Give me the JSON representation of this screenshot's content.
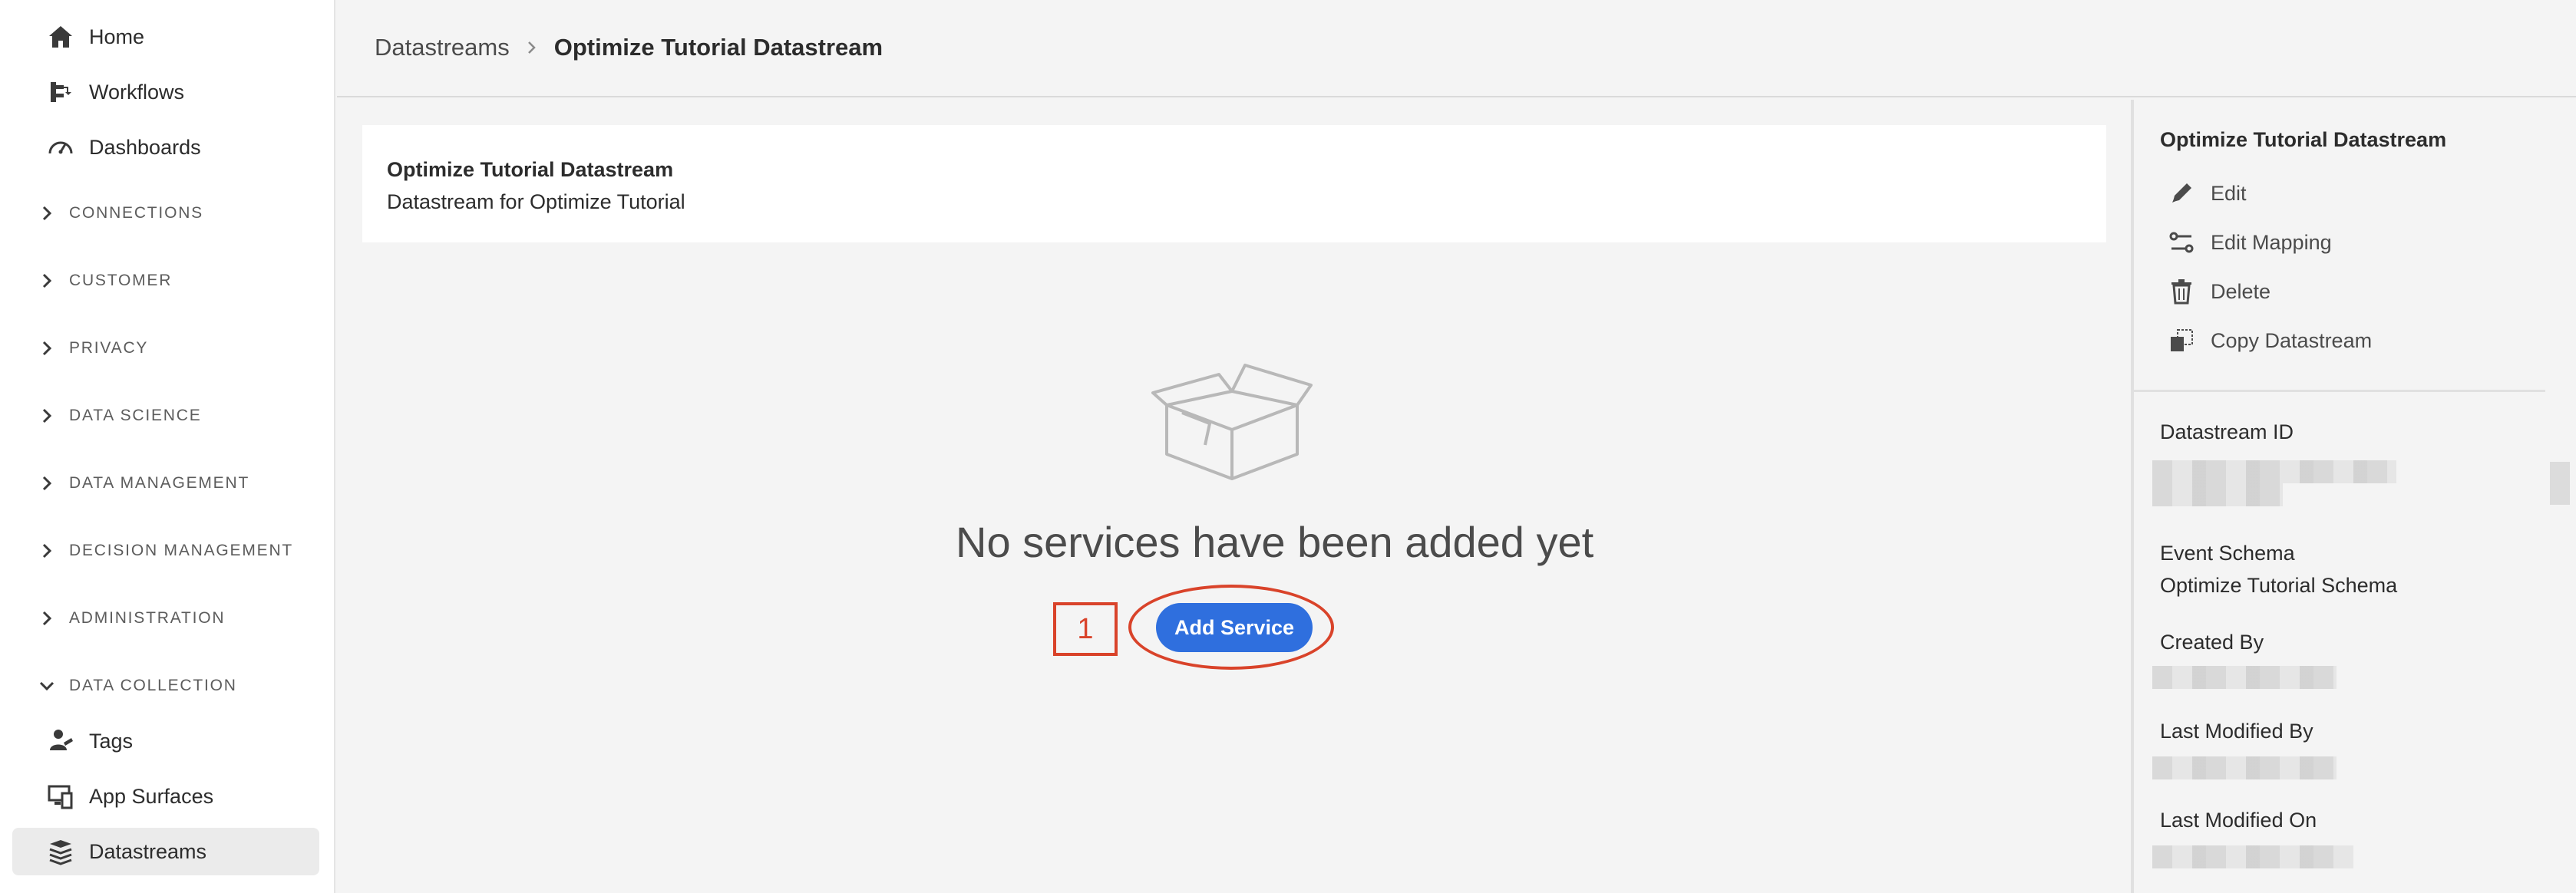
{
  "sidebar": {
    "top_items": [
      {
        "label": "Home",
        "icon": "home-icon"
      },
      {
        "label": "Workflows",
        "icon": "workflows-icon"
      },
      {
        "label": "Dashboards",
        "icon": "dashboard-gauge-icon"
      }
    ],
    "sections": [
      {
        "label": "CONNECTIONS"
      },
      {
        "label": "CUSTOMER"
      },
      {
        "label": "PRIVACY"
      },
      {
        "label": "DATA SCIENCE"
      },
      {
        "label": "DATA MANAGEMENT"
      },
      {
        "label": "DECISION MANAGEMENT"
      },
      {
        "label": "ADMINISTRATION"
      },
      {
        "label": "DATA COLLECTION"
      }
    ],
    "data_collection_items": [
      {
        "label": "Tags",
        "icon": "tags-icon"
      },
      {
        "label": "App Surfaces",
        "icon": "app-surfaces-icon"
      },
      {
        "label": "Datastreams",
        "icon": "datastreams-icon",
        "selected": true
      }
    ]
  },
  "breadcrumb": {
    "parent": "Datastreams",
    "current": "Optimize Tutorial Datastream"
  },
  "datastream_card": {
    "name": "Optimize Tutorial Datastream",
    "description": "Datastream for Optimize Tutorial"
  },
  "empty_state": {
    "message": "No services have been added yet",
    "button_label": "Add Service",
    "step_number": "1"
  },
  "right_panel": {
    "title": "Optimize Tutorial Datastream",
    "actions": [
      {
        "label": "Edit",
        "icon": "edit-pencil-icon"
      },
      {
        "label": "Edit Mapping",
        "icon": "edit-mapping-icon"
      },
      {
        "label": "Delete",
        "icon": "trash-icon"
      },
      {
        "label": "Copy Datastream",
        "icon": "copy-icon"
      }
    ],
    "properties": {
      "datastream_id_label": "Datastream ID",
      "event_schema_label": "Event Schema",
      "event_schema_value": "Optimize Tutorial Schema",
      "created_by_label": "Created By",
      "last_modified_by_label": "Last Modified By",
      "last_modified_on_label": "Last Modified On"
    }
  },
  "colors": {
    "accent_button": "#2f6fde",
    "annotation_red": "#d9432a",
    "sidebar_selected": "#ebebeb"
  }
}
